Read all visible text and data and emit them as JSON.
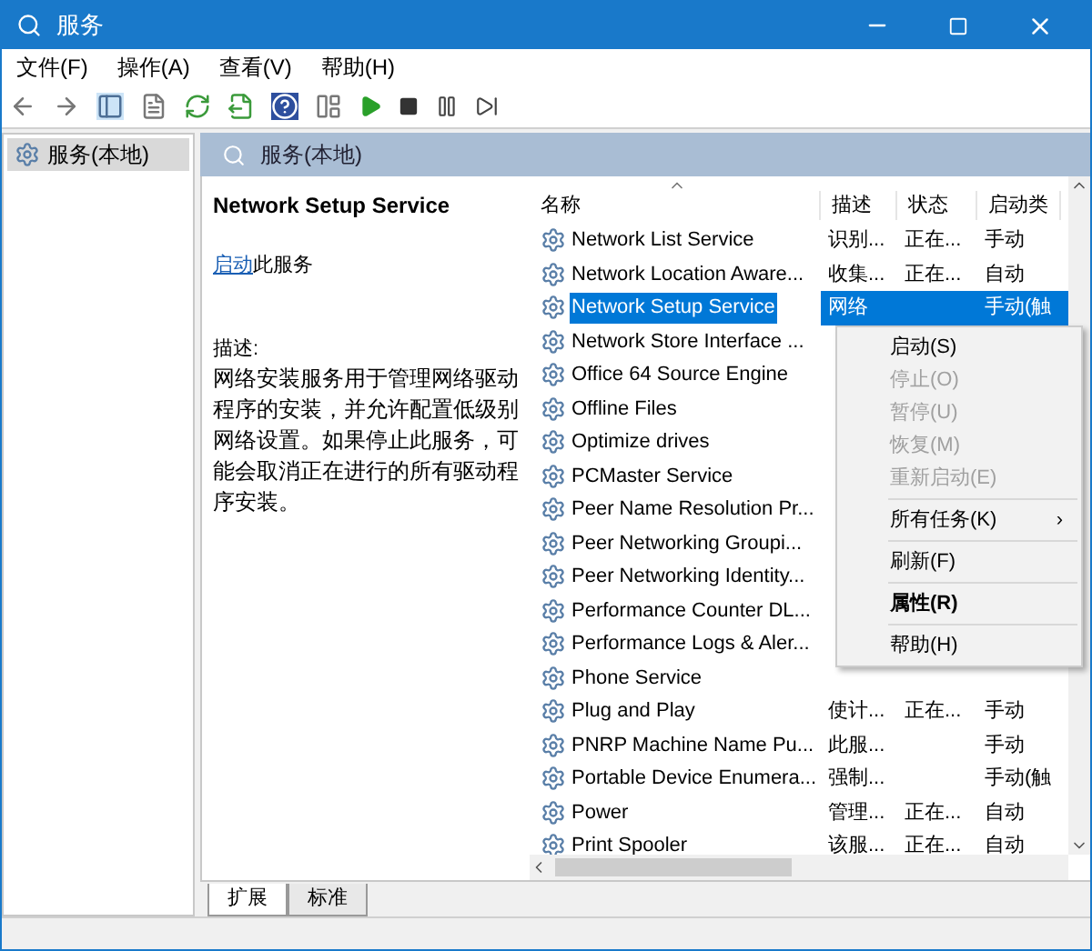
{
  "window": {
    "title": "服务"
  },
  "menu": [
    "文件(F)",
    "操作(A)",
    "查看(V)",
    "帮助(H)"
  ],
  "tree": [
    {
      "label": "服务(本地)",
      "selected": true
    }
  ],
  "panel": {
    "title": "服务(本地)"
  },
  "detail": {
    "name": "Network Setup Service",
    "link": "启动",
    "link_rest": "此服务",
    "desc_label": "描述:",
    "description": "网络安装服务用于管理网络驱动程序的安装，并允许配置低级别网络设置。如果停止此服务，可能会取消正在进行的所有驱动程序安装。"
  },
  "table": {
    "columns": [
      "名称",
      "描述",
      "状态",
      "启动类"
    ],
    "rows": [
      {
        "name": "Network List Service",
        "desc": "识别...",
        "status": "正在...",
        "startup": "手动",
        "selected": false
      },
      {
        "name": "Network Location Aware...",
        "desc": "收集...",
        "status": "正在...",
        "startup": "自动",
        "selected": false
      },
      {
        "name": "Network Setup Service",
        "desc": "网络",
        "startup": "手动(触",
        "selected": true
      },
      {
        "name": "Network Store Interface ...",
        "selected": false
      },
      {
        "name": "Office 64 Source Engine",
        "selected": false
      },
      {
        "name": "Offline Files",
        "selected": false
      },
      {
        "name": "Optimize drives",
        "selected": false
      },
      {
        "name": "PCMaster Service",
        "selected": false
      },
      {
        "name": "Peer Name Resolution Pr...",
        "selected": false
      },
      {
        "name": "Peer Networking Groupi...",
        "selected": false
      },
      {
        "name": "Peer Networking Identity...",
        "selected": false
      },
      {
        "name": "Performance Counter DL...",
        "selected": false
      },
      {
        "name": "Performance Logs & Aler...",
        "selected": false
      },
      {
        "name": "Phone Service",
        "selected": false
      },
      {
        "name": "Plug and Play",
        "desc": "使计...",
        "status": "正在...",
        "startup": "手动",
        "selected": false
      },
      {
        "name": "PNRP Machine Name Pu...",
        "desc": "此服...",
        "startup": "手动",
        "selected": false
      },
      {
        "name": "Portable Device Enumera...",
        "desc": "强制...",
        "startup": "手动(触",
        "selected": false
      },
      {
        "name": "Power",
        "desc": "管理...",
        "status": "正在...",
        "startup": "自动",
        "selected": false
      },
      {
        "name": "Print Spooler",
        "desc": "该服...",
        "status": "正在...",
        "startup": "自动",
        "selected": false
      }
    ]
  },
  "context_menu": [
    {
      "kind": "item",
      "label": "启动(S)",
      "disabled": false
    },
    {
      "kind": "item",
      "label": "停止(O)",
      "disabled": true
    },
    {
      "kind": "item",
      "label": "暂停(U)",
      "disabled": true
    },
    {
      "kind": "item",
      "label": "恢复(M)",
      "disabled": true
    },
    {
      "kind": "item",
      "label": "重新启动(E)",
      "disabled": true
    },
    {
      "kind": "separator"
    },
    {
      "kind": "submenu",
      "label": "所有任务(K)",
      "arrow": "›",
      "disabled": false
    },
    {
      "kind": "separator"
    },
    {
      "kind": "item",
      "label": "刷新(F)",
      "disabled": false
    },
    {
      "kind": "separator"
    },
    {
      "kind": "item",
      "label": "属性(R)",
      "disabled": false,
      "bold": true
    },
    {
      "kind": "separator"
    },
    {
      "kind": "item",
      "label": "帮助(H)",
      "disabled": false
    }
  ],
  "bottom_tabs": [
    {
      "label": "扩展",
      "selected": true
    },
    {
      "label": "标准",
      "selected": false
    }
  ]
}
